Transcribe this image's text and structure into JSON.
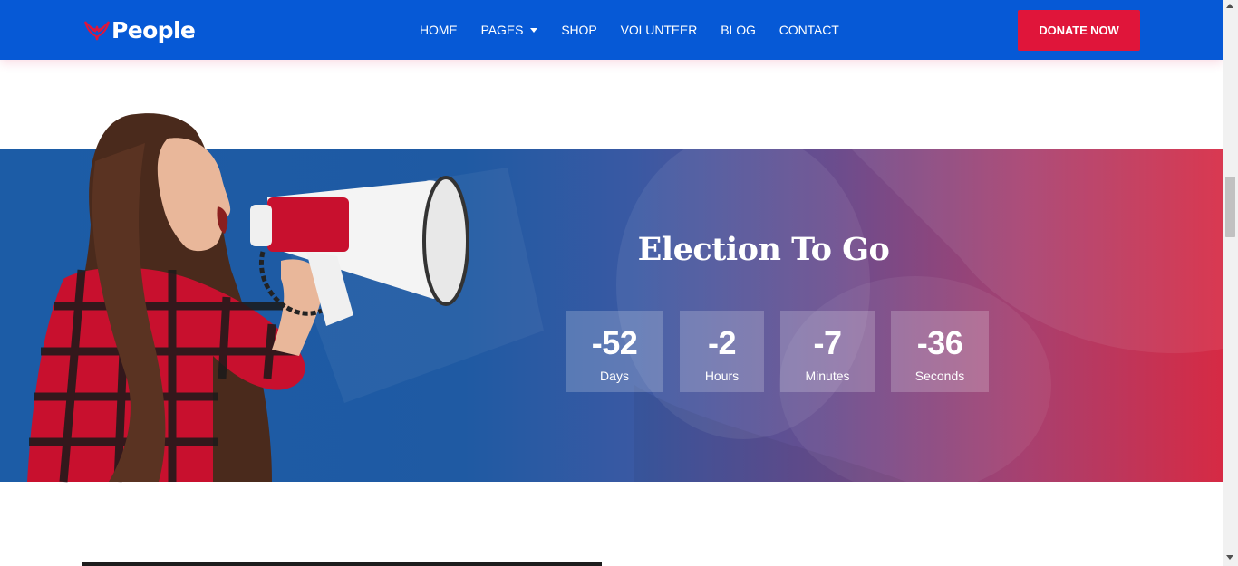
{
  "header": {
    "logo_text": "People",
    "nav": [
      {
        "label": "HOME",
        "has_caret": false
      },
      {
        "label": "PAGES",
        "has_caret": true
      },
      {
        "label": "SHOP",
        "has_caret": false
      },
      {
        "label": "VOLUNTEER",
        "has_caret": false
      },
      {
        "label": "BLOG",
        "has_caret": false
      },
      {
        "label": "CONTACT",
        "has_caret": false
      }
    ],
    "donate_label": "DONATE NOW"
  },
  "election": {
    "title": "Election To Go",
    "countdown": [
      {
        "value": "-52",
        "label": "Days"
      },
      {
        "value": "-2",
        "label": "Hours"
      },
      {
        "value": "-7",
        "label": "Minutes"
      },
      {
        "value": "-36",
        "label": "Seconds"
      }
    ]
  },
  "colors": {
    "header_bg": "#0659d6",
    "donate_bg": "#e0153a",
    "gradient_start": "#1c5ca6",
    "gradient_end": "#d62a44"
  },
  "icons": {
    "logo": "wings-logo-icon",
    "nav_caret": "caret-down-icon",
    "scroll_up": "scroll-up-arrow-icon",
    "scroll_down": "scroll-down-arrow-icon"
  }
}
